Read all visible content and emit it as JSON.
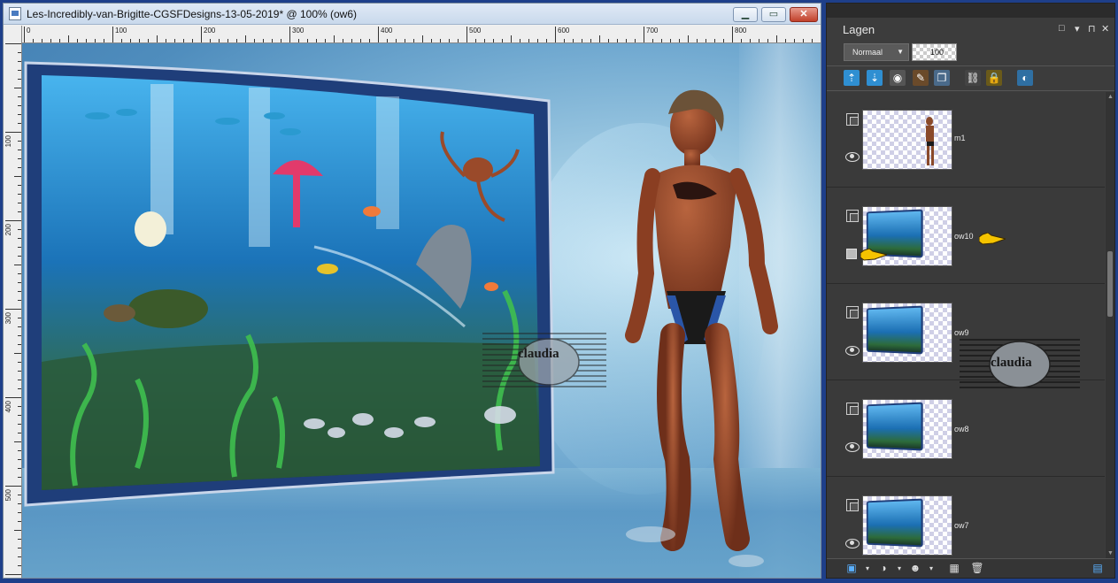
{
  "window": {
    "title": "Les-Incredibly-van-Brigitte-CGSFDesigns-13-05-2019* @ 100% (ow6)",
    "minimize": "▁",
    "maximize": "▭",
    "close": "✕"
  },
  "ruler_h_labels": [
    "0",
    "100",
    "200",
    "300",
    "400",
    "500",
    "600",
    "700",
    "800"
  ],
  "ruler_v_labels": [
    "100",
    "200",
    "300",
    "400",
    "500"
  ],
  "watermark": "claudia",
  "palette": {
    "title": "Lagen",
    "controls": [
      "□",
      "▾",
      "⊓",
      "✕"
    ],
    "blend_mode": "Normaal",
    "opacity": "100",
    "layers": [
      {
        "name": "m1",
        "visible": true,
        "thumb": "figure"
      },
      {
        "name": "ow10",
        "visible": false,
        "thumb": "tank"
      },
      {
        "name": "ow9",
        "visible": true,
        "thumb": "tank"
      },
      {
        "name": "ow8",
        "visible": true,
        "thumb": "tank"
      },
      {
        "name": "ow7",
        "visible": true,
        "thumb": "tank"
      }
    ]
  },
  "colors": {
    "accent_blue": "#1e3f8a",
    "palette_bg": "#3c3c3c",
    "pointer_yellow": "#f5c400"
  }
}
